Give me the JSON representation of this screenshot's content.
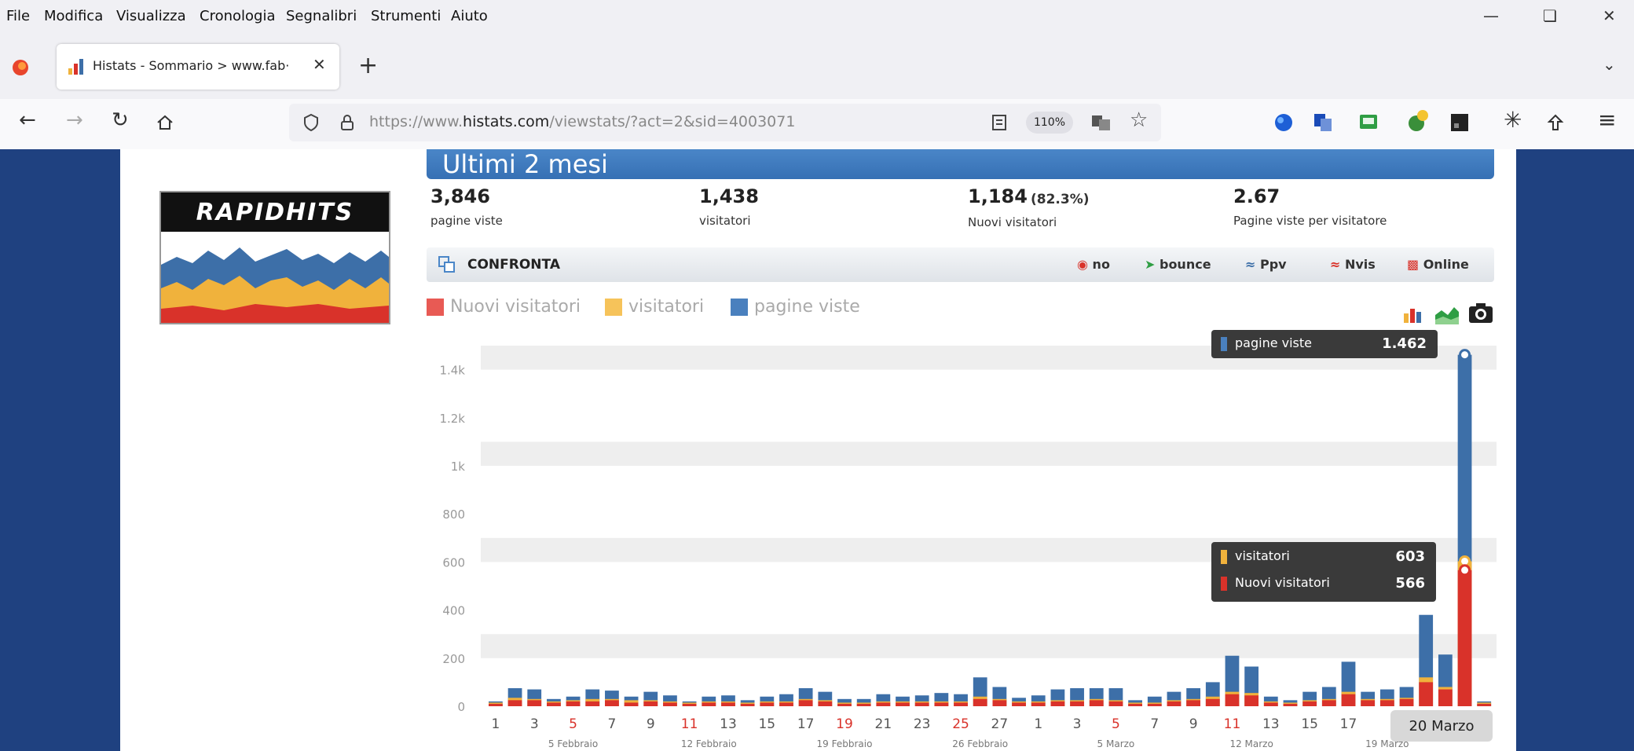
{
  "menu": [
    "File",
    "Modifica",
    "Visualizza",
    "Cronologia",
    "Segnalibri",
    "Strumenti",
    "Aiuto"
  ],
  "tab": {
    "title": "Histats - Sommario > www.fab·"
  },
  "url": {
    "protocol": "https://www.",
    "host": "histats.com",
    "path": "/viewstats/?act=2&sid=4003071",
    "zoom": "110%"
  },
  "page": {
    "banner_title": "Ultimi 2 mesi",
    "logo_text": "RAPIDHITS",
    "stats": [
      {
        "value": "3,846",
        "extra": "",
        "label": "pagine viste"
      },
      {
        "value": "1,438",
        "extra": "",
        "label": "visitatori"
      },
      {
        "value": "1,184",
        "extra": "(82.3%)",
        "label": "Nuovi visitatori"
      },
      {
        "value": "2.67",
        "extra": "",
        "label": "Pagine viste per visitatore"
      }
    ],
    "compare": {
      "label": "CONFRONTA",
      "options": [
        "no",
        "bounce",
        "Ppv",
        "Nvis",
        "Online"
      ]
    },
    "legend": [
      "Nuovi visitatori",
      "visitatori",
      "pagine viste"
    ]
  },
  "chart_data": {
    "type": "bar",
    "colors": {
      "nuovi": "#d9322a",
      "visitatori": "#f0b23c",
      "pagine": "#3d6fa8"
    },
    "ylim": [
      0,
      1500
    ],
    "yticks": [
      "1.4k",
      "1.2k",
      "1k",
      "800",
      "600",
      "400",
      "200",
      "0"
    ],
    "ytick_values": [
      1400,
      1200,
      1000,
      800,
      600,
      400,
      200,
      0
    ],
    "xtick_labels": [
      "1",
      "3",
      "5",
      "7",
      "9",
      "11",
      "13",
      "15",
      "17",
      "19",
      "21",
      "23",
      "25",
      "27",
      "1",
      "3",
      "5",
      "7",
      "9",
      "11",
      "13",
      "15",
      "17"
    ],
    "xtick_red": [
      "5",
      "11",
      "19",
      "25"
    ],
    "week_labels": [
      "5 Febbraio",
      "12 Febbraio",
      "19 Febbraio",
      "26 Febbraio",
      "5 Marzo",
      "12 Marzo",
      "19 Marzo"
    ],
    "pagine_viste": [
      20,
      75,
      70,
      30,
      40,
      70,
      65,
      40,
      60,
      45,
      20,
      40,
      45,
      25,
      40,
      50,
      75,
      60,
      30,
      30,
      50,
      40,
      45,
      55,
      50,
      120,
      80,
      35,
      45,
      70,
      75,
      75,
      75,
      25,
      40,
      60,
      75,
      100,
      210,
      165,
      40,
      25,
      60,
      80,
      185,
      60,
      70,
      80,
      380,
      215,
      1462,
      20
    ],
    "visitatori": [
      15,
      35,
      30,
      20,
      25,
      30,
      30,
      25,
      25,
      20,
      15,
      20,
      20,
      15,
      20,
      20,
      30,
      25,
      15,
      15,
      20,
      20,
      20,
      20,
      20,
      40,
      30,
      20,
      20,
      25,
      25,
      30,
      25,
      15,
      15,
      25,
      30,
      40,
      60,
      55,
      20,
      15,
      25,
      30,
      60,
      30,
      30,
      35,
      120,
      80,
      603,
      15
    ],
    "nuovi_visitatori": [
      10,
      25,
      25,
      15,
      20,
      20,
      25,
      15,
      20,
      15,
      10,
      15,
      15,
      10,
      15,
      15,
      25,
      20,
      10,
      10,
      15,
      15,
      15,
      15,
      15,
      30,
      25,
      15,
      15,
      20,
      20,
      25,
      20,
      10,
      10,
      20,
      25,
      30,
      50,
      45,
      15,
      10,
      20,
      25,
      50,
      25,
      25,
      30,
      100,
      70,
      566,
      10
    ],
    "tooltip_top": {
      "label": "pagine viste",
      "value": "1.462"
    },
    "tooltip_mid": [
      {
        "label": "visitatori",
        "value": "603"
      },
      {
        "label": "Nuovi visitatori",
        "value": "566"
      }
    ],
    "x_hover_label": "20 Marzo"
  }
}
